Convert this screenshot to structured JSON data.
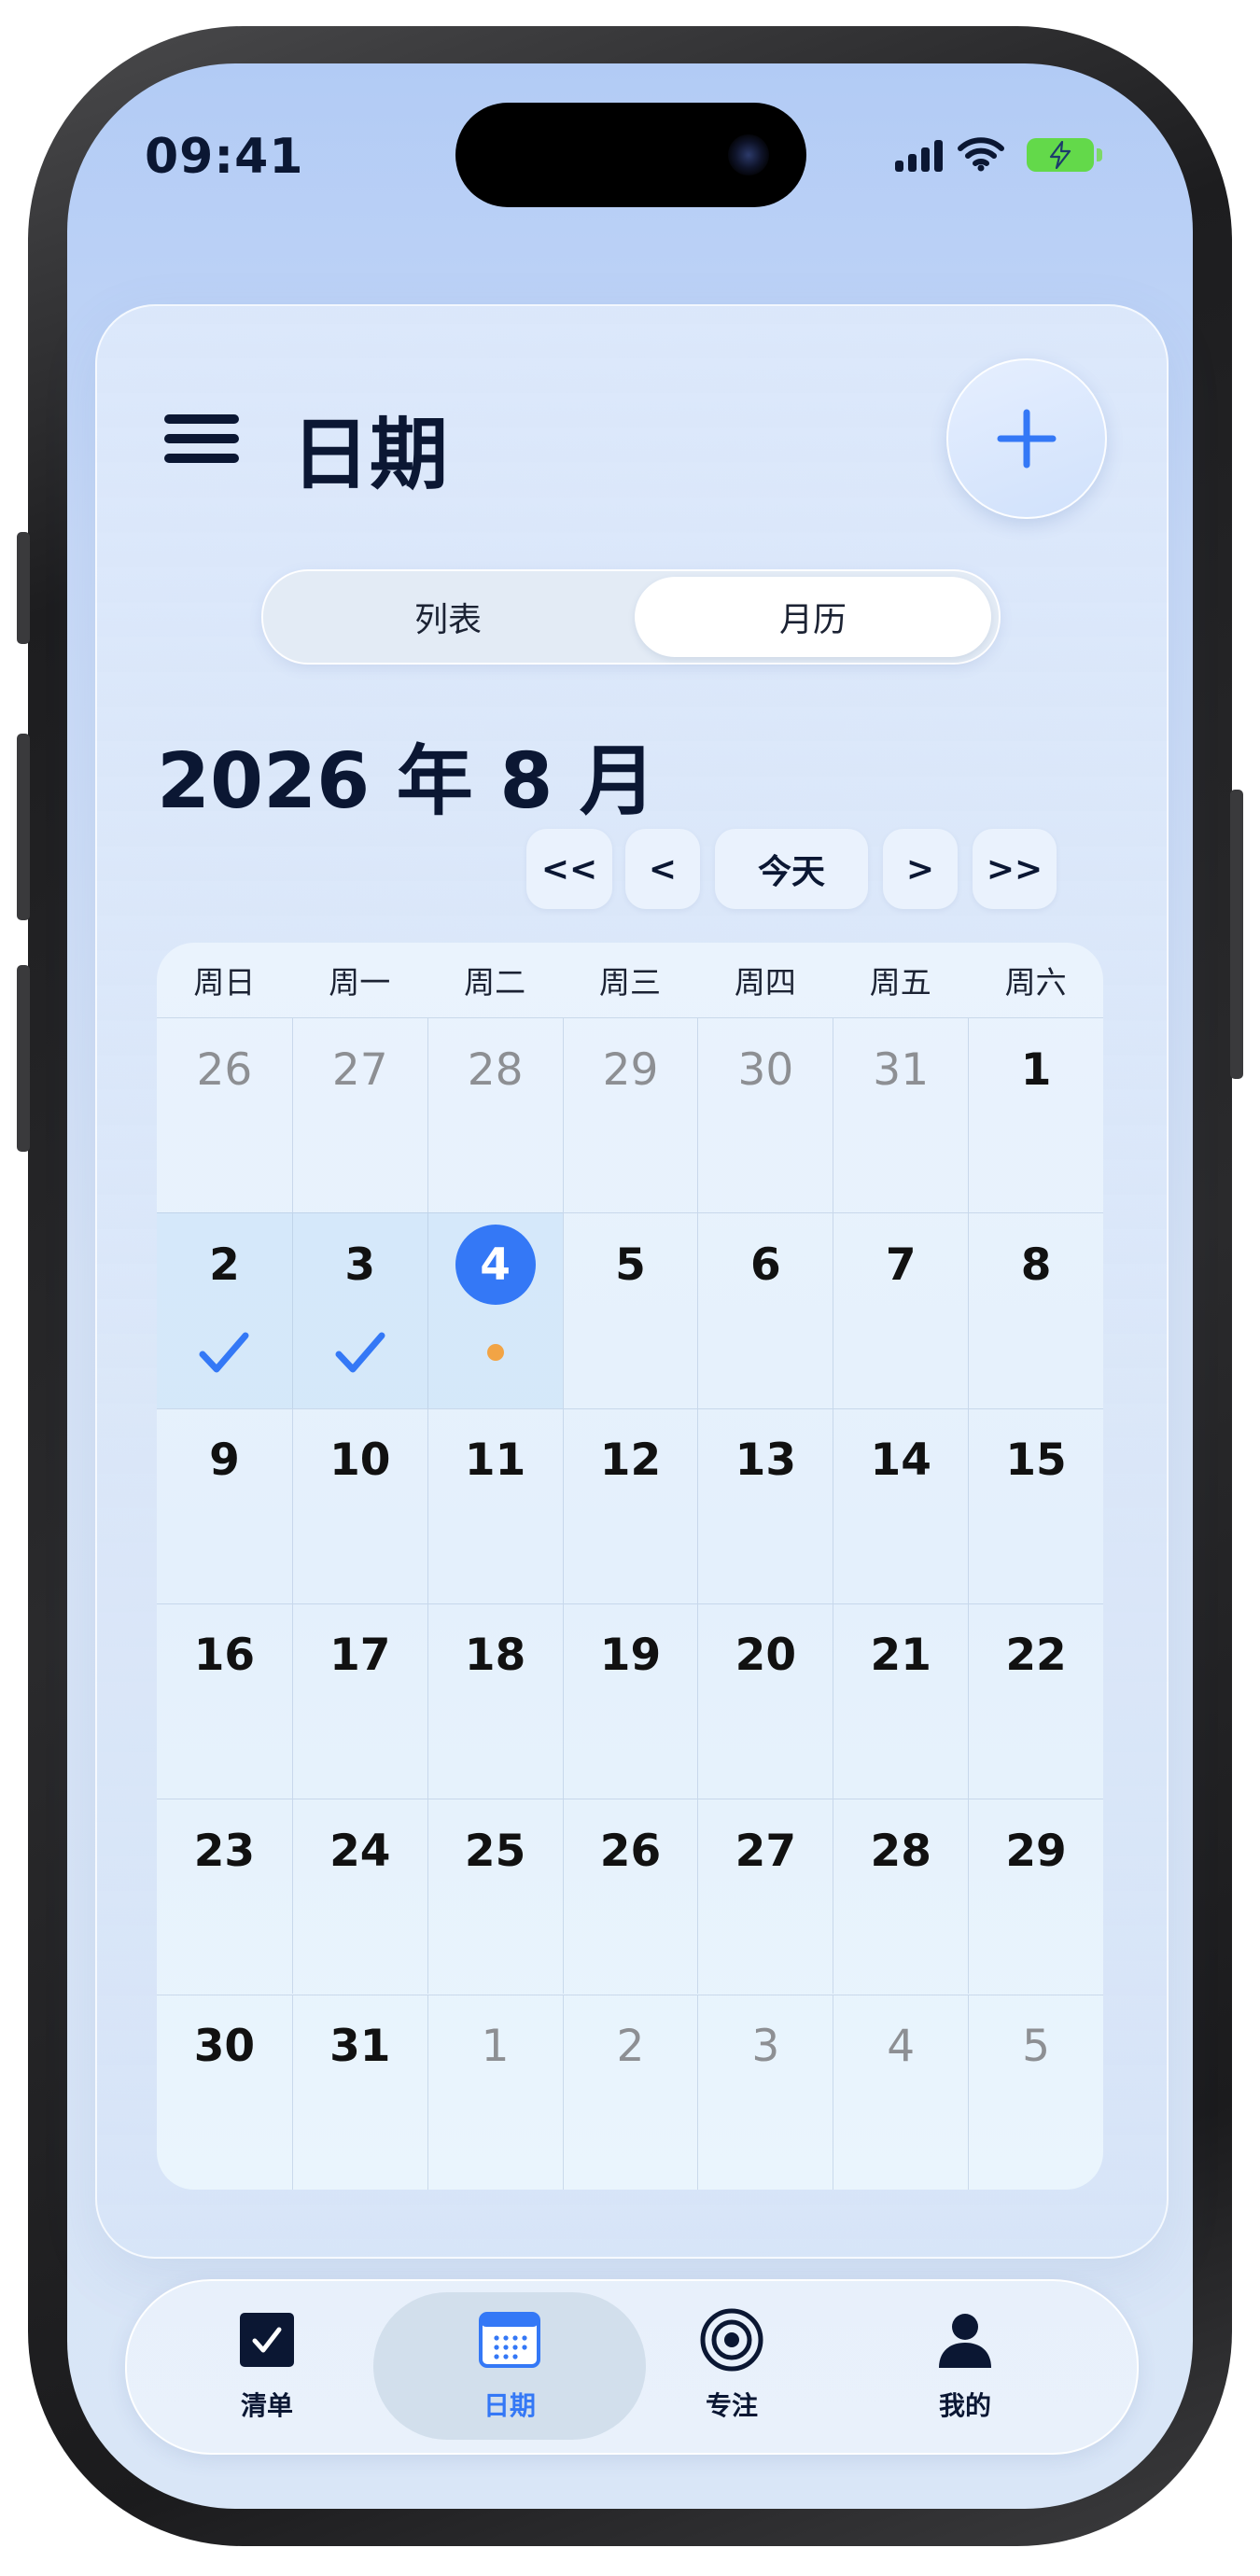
{
  "status_bar": {
    "time": "09:41"
  },
  "header": {
    "title": "日期"
  },
  "view_switch": {
    "options": [
      "列表",
      "月历"
    ],
    "selected": "月历"
  },
  "month": {
    "title": "2026 年 8 月"
  },
  "nav": {
    "prev_year": "<<",
    "prev": "<",
    "today": "今天",
    "next": ">",
    "next_year": ">>"
  },
  "calendar": {
    "weekdays": [
      "周日",
      "周一",
      "周二",
      "周三",
      "周四",
      "周五",
      "周六"
    ],
    "weeks": [
      [
        {
          "day": "26",
          "muted": true
        },
        {
          "day": "27",
          "muted": true
        },
        {
          "day": "28",
          "muted": true
        },
        {
          "day": "29",
          "muted": true
        },
        {
          "day": "30",
          "muted": true
        },
        {
          "day": "31",
          "muted": true
        },
        {
          "day": "1"
        }
      ],
      [
        {
          "day": "2",
          "mark": "check",
          "highlight": true
        },
        {
          "day": "3",
          "mark": "check",
          "highlight": true
        },
        {
          "day": "4",
          "today": true,
          "mark": "dot",
          "highlight": true
        },
        {
          "day": "5"
        },
        {
          "day": "6"
        },
        {
          "day": "7"
        },
        {
          "day": "8"
        }
      ],
      [
        {
          "day": "9"
        },
        {
          "day": "10"
        },
        {
          "day": "11"
        },
        {
          "day": "12"
        },
        {
          "day": "13"
        },
        {
          "day": "14"
        },
        {
          "day": "15"
        }
      ],
      [
        {
          "day": "16"
        },
        {
          "day": "17"
        },
        {
          "day": "18"
        },
        {
          "day": "19"
        },
        {
          "day": "20"
        },
        {
          "day": "21"
        },
        {
          "day": "22"
        }
      ],
      [
        {
          "day": "23"
        },
        {
          "day": "24"
        },
        {
          "day": "25"
        },
        {
          "day": "26"
        },
        {
          "day": "27"
        },
        {
          "day": "28"
        },
        {
          "day": "29"
        }
      ],
      [
        {
          "day": "30"
        },
        {
          "day": "31"
        },
        {
          "day": "1",
          "muted": true
        },
        {
          "day": "2",
          "muted": true
        },
        {
          "day": "3",
          "muted": true
        },
        {
          "day": "4",
          "muted": true
        },
        {
          "day": "5",
          "muted": true
        }
      ]
    ]
  },
  "tabbar": {
    "items": [
      {
        "label": "清单",
        "icon": "checkbox-icon"
      },
      {
        "label": "日期",
        "icon": "calendar-icon",
        "active": true
      },
      {
        "label": "专注",
        "icon": "target-icon"
      },
      {
        "label": "我的",
        "icon": "person-icon"
      }
    ]
  },
  "colors": {
    "accent": "#3478f6",
    "dot": "#f2a445",
    "text": "#0b1733",
    "muted": "#8d8f93"
  }
}
